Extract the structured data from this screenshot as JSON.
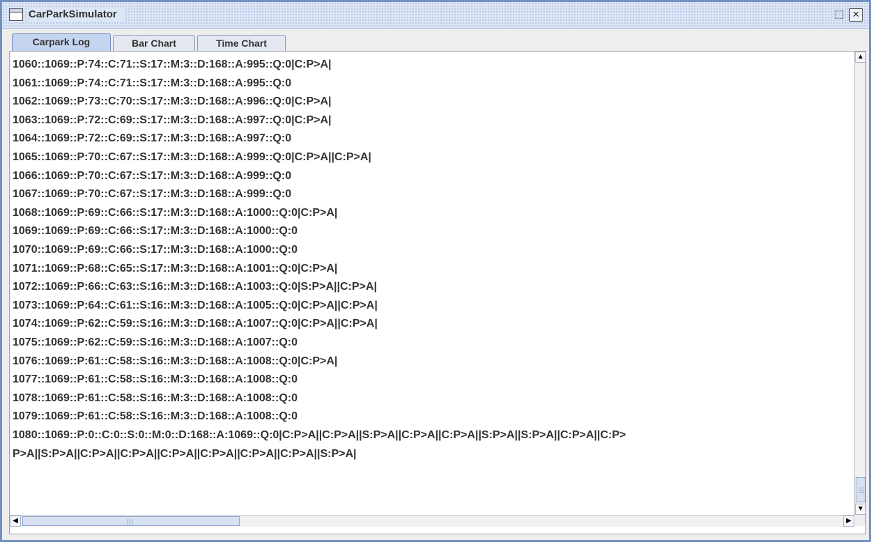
{
  "window": {
    "title": "CarParkSimulator",
    "restore_glyph": "⬚",
    "close_glyph": "✕"
  },
  "tabs": [
    {
      "label": "Carpark Log",
      "selected": true
    },
    {
      "label": "Bar Chart",
      "selected": false
    },
    {
      "label": "Time Chart",
      "selected": false
    }
  ],
  "log": {
    "lines": [
      "1060::1069::P:74::C:71::S:17::M:3::D:168::A:995::Q:0|C:P>A|",
      "1061::1069::P:74::C:71::S:17::M:3::D:168::A:995::Q:0",
      "1062::1069::P:73::C:70::S:17::M:3::D:168::A:996::Q:0|C:P>A|",
      "1063::1069::P:72::C:69::S:17::M:3::D:168::A:997::Q:0|C:P>A|",
      "1064::1069::P:72::C:69::S:17::M:3::D:168::A:997::Q:0",
      "1065::1069::P:70::C:67::S:17::M:3::D:168::A:999::Q:0|C:P>A||C:P>A|",
      "1066::1069::P:70::C:67::S:17::M:3::D:168::A:999::Q:0",
      "1067::1069::P:70::C:67::S:17::M:3::D:168::A:999::Q:0",
      "1068::1069::P:69::C:66::S:17::M:3::D:168::A:1000::Q:0|C:P>A|",
      "1069::1069::P:69::C:66::S:17::M:3::D:168::A:1000::Q:0",
      "1070::1069::P:69::C:66::S:17::M:3::D:168::A:1000::Q:0",
      "1071::1069::P:68::C:65::S:17::M:3::D:168::A:1001::Q:0|C:P>A|",
      "1072::1069::P:66::C:63::S:16::M:3::D:168::A:1003::Q:0|S:P>A||C:P>A|",
      "1073::1069::P:64::C:61::S:16::M:3::D:168::A:1005::Q:0|C:P>A||C:P>A|",
      "1074::1069::P:62::C:59::S:16::M:3::D:168::A:1007::Q:0|C:P>A||C:P>A|",
      "1075::1069::P:62::C:59::S:16::M:3::D:168::A:1007::Q:0",
      "1076::1069::P:61::C:58::S:16::M:3::D:168::A:1008::Q:0|C:P>A|",
      "1077::1069::P:61::C:58::S:16::M:3::D:168::A:1008::Q:0",
      "1078::1069::P:61::C:58::S:16::M:3::D:168::A:1008::Q:0",
      "1079::1069::P:61::C:58::S:16::M:3::D:168::A:1008::Q:0",
      "1080::1069::P:0::C:0::S:0::M:0::D:168::A:1069::Q:0|C:P>A||C:P>A||S:P>A||C:P>A||C:P>A||S:P>A||S:P>A||C:P>A||C:P>",
      "P>A||S:P>A||C:P>A||C:P>A||C:P>A||C:P>A||C:P>A||C:P>A||S:P>A|"
    ]
  },
  "scrollbars": {
    "up_arrow": "▲",
    "down_arrow": "▼",
    "left_arrow": "◀",
    "right_arrow": "▶"
  }
}
